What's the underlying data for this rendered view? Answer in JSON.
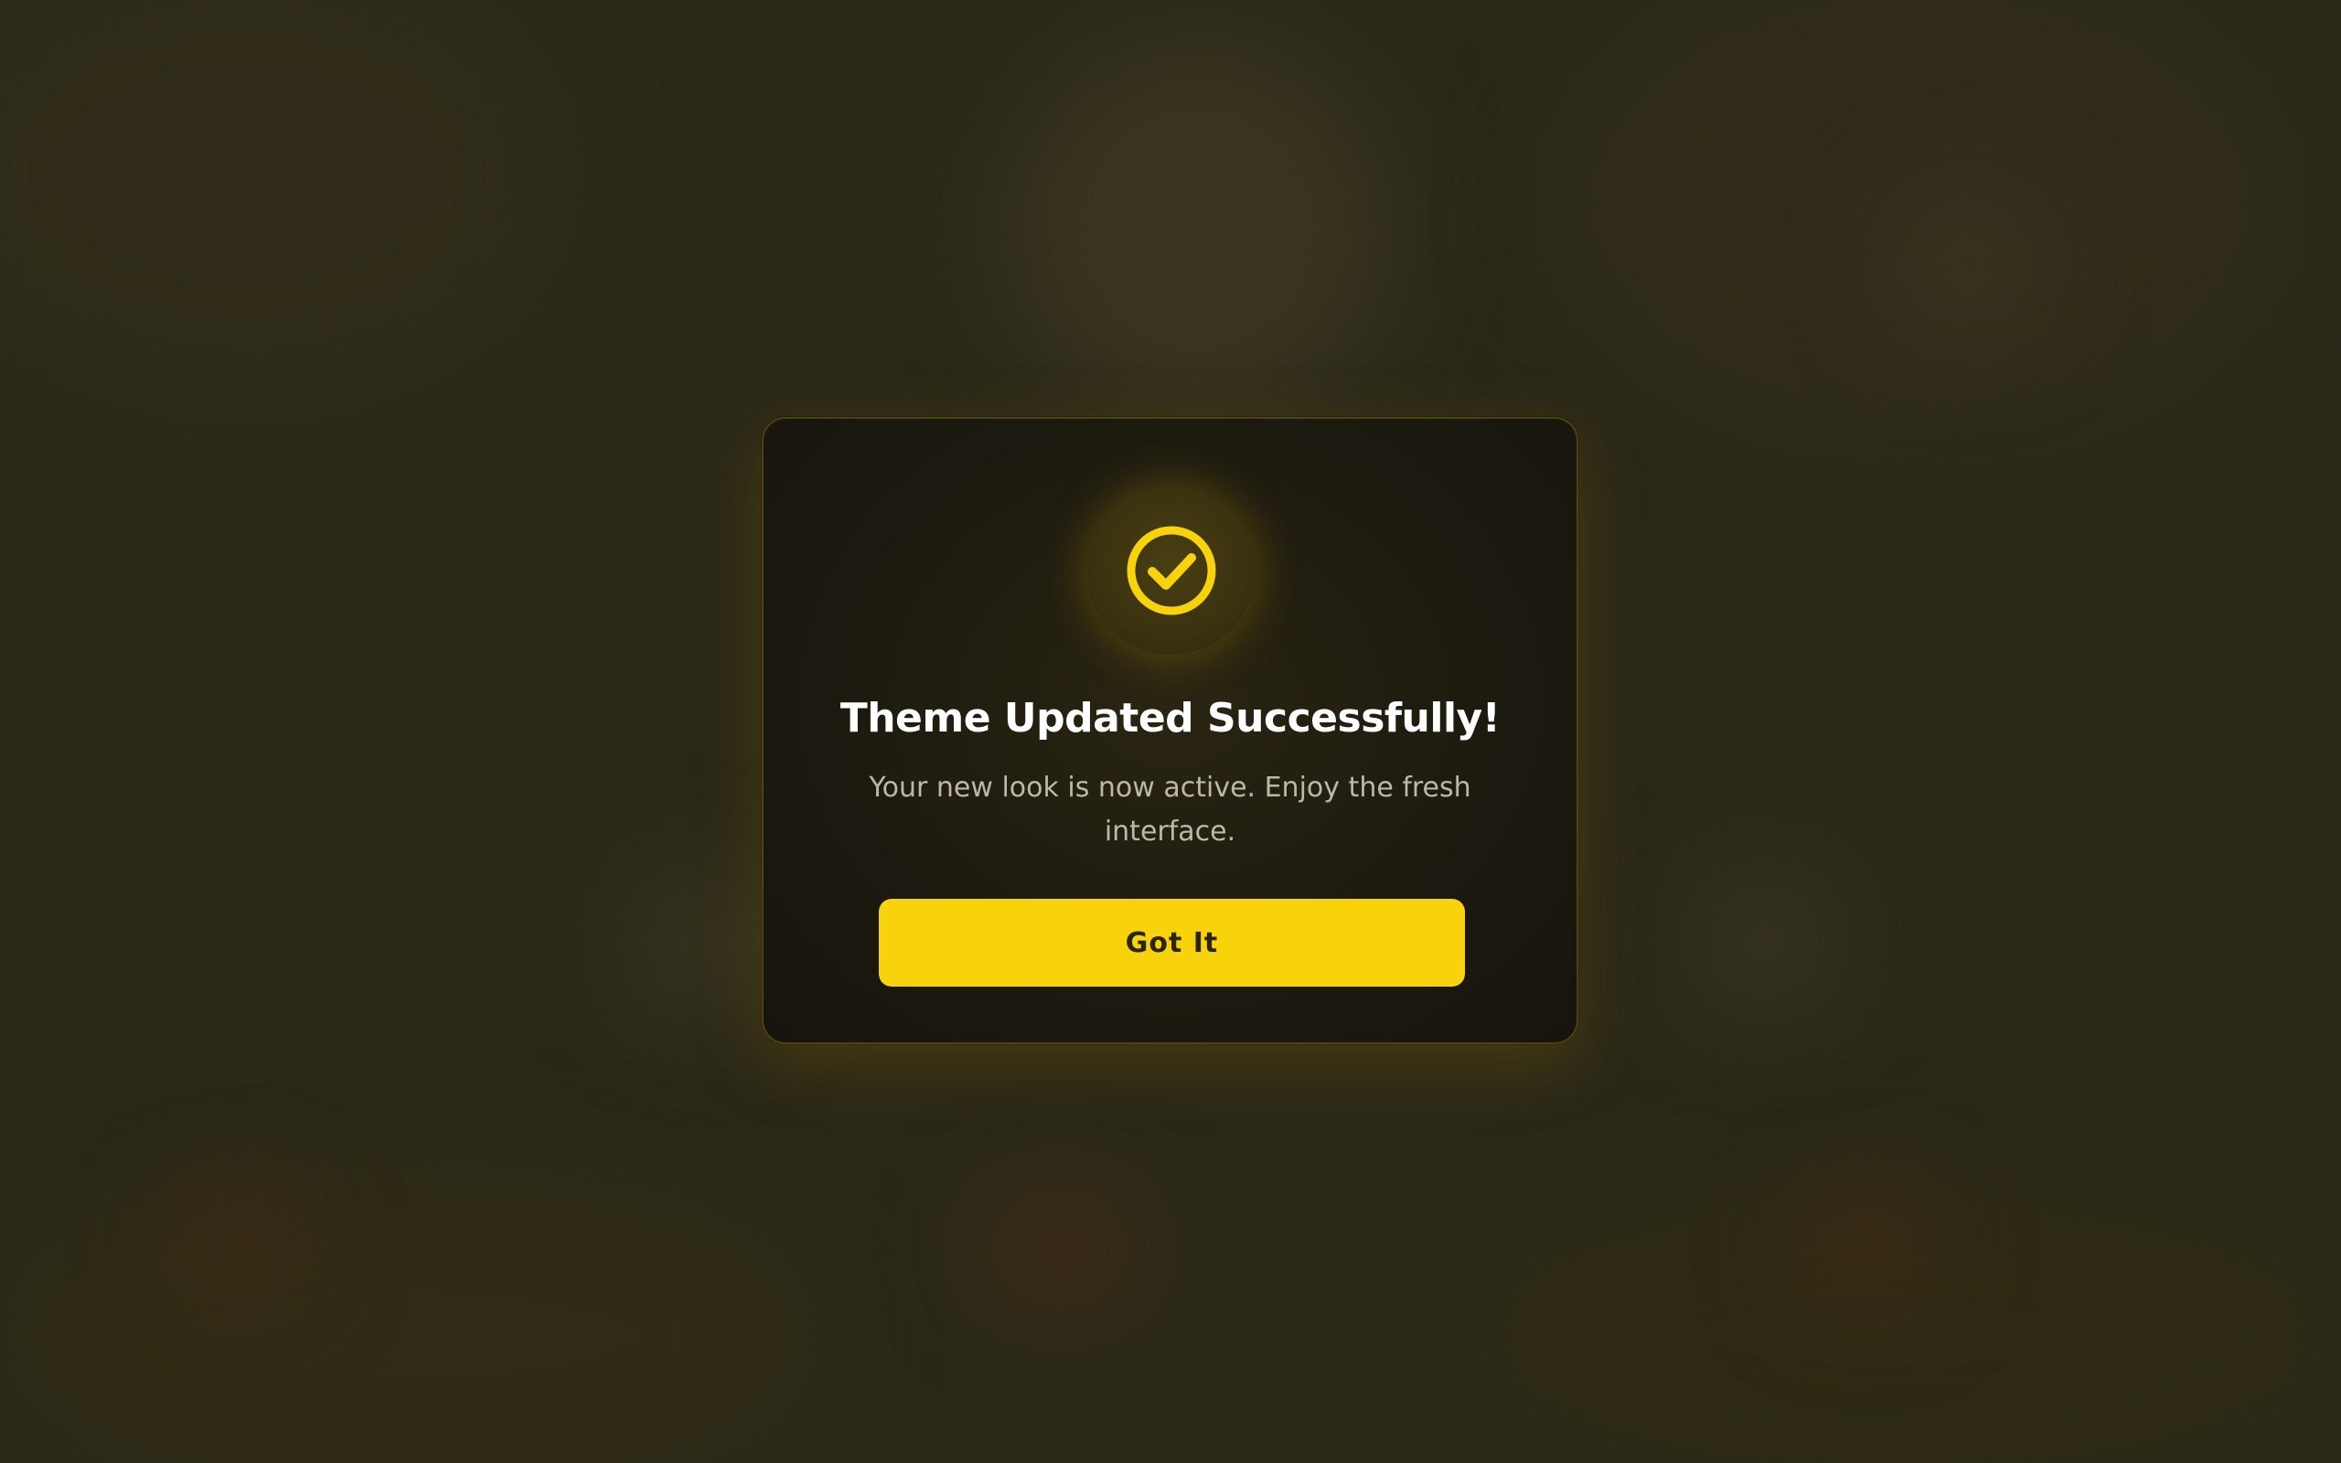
{
  "dialog": {
    "icon": "check-circle-icon",
    "title": "Theme Updated Successfully!",
    "message": "Your new look is now active. Enjoy the fresh interface.",
    "button_label": "Got It"
  },
  "colors": {
    "accent": "#f8d20a",
    "modal_background": "#1d1a10",
    "page_background": "#2b2818",
    "title_text": "#ffffff",
    "message_text": "#bcb7a6",
    "button_text": "#2a2410"
  }
}
